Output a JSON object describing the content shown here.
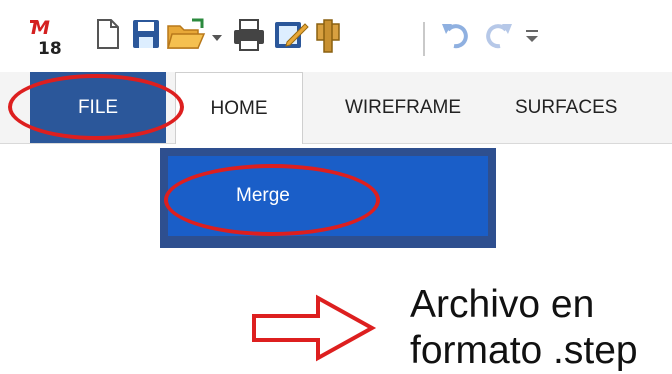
{
  "quick_access_toolbar": {
    "app_logo": {
      "number": "18",
      "icon": "app-logo-icon"
    },
    "icons": [
      "new-file-icon",
      "save-icon",
      "open-folder-icon",
      "dropdown-arrow-icon",
      "print-icon",
      "edit-icon",
      "library-icon",
      "undo-icon",
      "redo-icon",
      "customize-toolbar-icon"
    ]
  },
  "ribbon": {
    "tabs": [
      {
        "label": "FILE",
        "active": true
      },
      {
        "label": "HOME"
      },
      {
        "label": "WIREFRAME"
      },
      {
        "label": "SURFACES"
      }
    ]
  },
  "file_menu": {
    "items": [
      {
        "label": "Merge"
      }
    ]
  },
  "annotation": {
    "line1": "Archivo en",
    "line2": "formato .step"
  },
  "colors": {
    "file_tab": "#2b579a",
    "menu_bg": "#2e4f8f",
    "menu_item": "#1a5ec8",
    "highlight": "#dd1f1f"
  }
}
